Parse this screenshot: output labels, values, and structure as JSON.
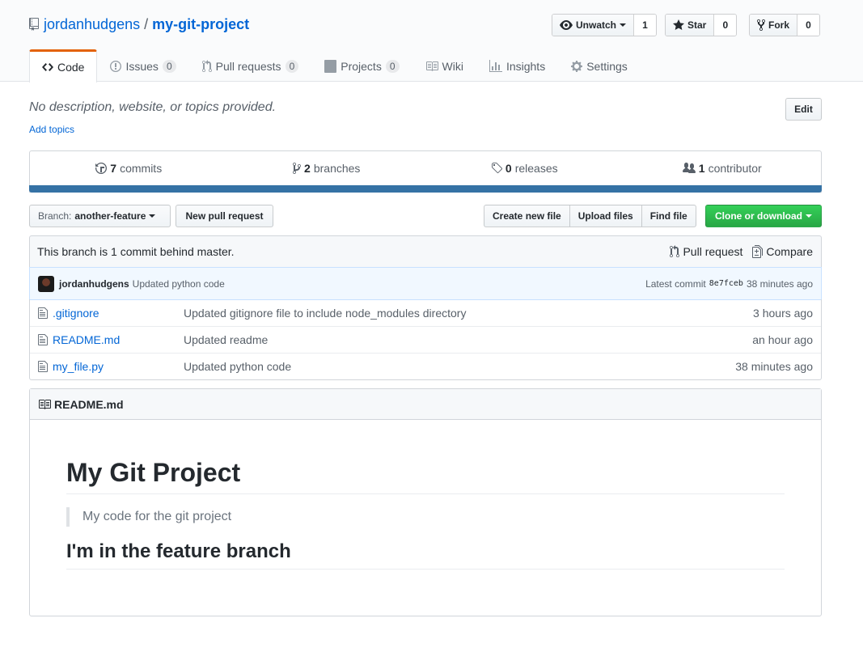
{
  "repo": {
    "owner": "jordanhudgens",
    "separator": "/",
    "name": "my-git-project"
  },
  "actions": {
    "watch_label": "Unwatch",
    "watch_count": "1",
    "star_label": "Star",
    "star_count": "0",
    "fork_label": "Fork",
    "fork_count": "0"
  },
  "nav": {
    "code": "Code",
    "issues": "Issues",
    "issues_count": "0",
    "pulls": "Pull requests",
    "pulls_count": "0",
    "projects": "Projects",
    "projects_count": "0",
    "wiki": "Wiki",
    "insights": "Insights",
    "settings": "Settings"
  },
  "description": {
    "text": "No description, website, or topics provided.",
    "add_topics": "Add topics",
    "edit_label": "Edit"
  },
  "summary": {
    "commits_num": "7",
    "commits_label": "commits",
    "branches_num": "2",
    "branches_label": "branches",
    "releases_num": "0",
    "releases_label": "releases",
    "contributors_num": "1",
    "contributors_label": "contributor",
    "language_color": "#3572a5"
  },
  "file_nav": {
    "branch_prefix": "Branch:",
    "branch_name": "another-feature",
    "new_pr": "New pull request",
    "create_file": "Create new file",
    "upload_files": "Upload files",
    "find_file": "Find file",
    "clone": "Clone or download"
  },
  "infobar": {
    "message": "This branch is 1 commit behind master.",
    "pull_request": "Pull request",
    "compare": "Compare"
  },
  "commit": {
    "author": "jordanhudgens",
    "message": "Updated python code",
    "latest_label": "Latest commit",
    "sha": "8e7fceb",
    "age": "38 minutes ago"
  },
  "files": [
    {
      "name": ".gitignore",
      "message": "Updated gitignore file to include node_modules directory",
      "age": "3 hours ago"
    },
    {
      "name": "README.md",
      "message": "Updated readme",
      "age": "an hour ago"
    },
    {
      "name": "my_file.py",
      "message": "Updated python code",
      "age": "38 minutes ago"
    }
  ],
  "readme": {
    "filename": "README.md",
    "h1": "My Git Project",
    "quote": "My code for the git project",
    "h2": "I'm in the feature branch"
  },
  "colors": {
    "link": "#0366d6",
    "selected_tab_border": "#e36209",
    "clone_green": "#28a745"
  }
}
